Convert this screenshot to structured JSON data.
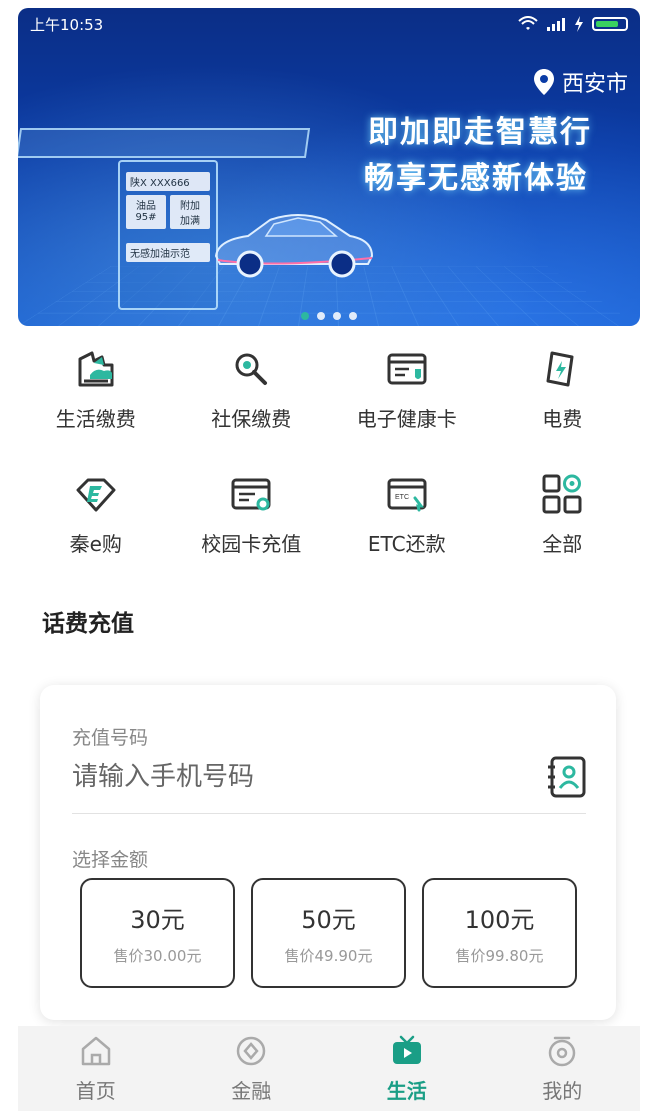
{
  "status_bar": {
    "time": "上午10:53"
  },
  "banner": {
    "location": "西安市",
    "slogan_line1": "即加即走智慧行",
    "slogan_line2": "畅享无感新体验",
    "pump_plate": "陕X XXX666",
    "pump_fuel": "油品\n95#",
    "pump_amount": "附加\n加满",
    "pump_footer": "无感加油示范",
    "dots": 4,
    "active_dot": 0
  },
  "menu": {
    "items": [
      {
        "label": "生活缴费",
        "icon": "house-bill-icon"
      },
      {
        "label": "社保缴费",
        "icon": "search-magnifier-icon"
      },
      {
        "label": "电子健康卡",
        "icon": "health-card-icon"
      },
      {
        "label": "电费",
        "icon": "electric-bolt-card-icon"
      },
      {
        "label": "秦e购",
        "icon": "diamond-e-icon"
      },
      {
        "label": "校园卡充值",
        "icon": "campus-card-icon"
      },
      {
        "label": "ETC还款",
        "icon": "etc-card-icon"
      },
      {
        "label": "全部",
        "icon": "grid-all-icon"
      }
    ]
  },
  "topup": {
    "section_title": "话费充值",
    "number_label": "充值号码",
    "number_placeholder": "请输入手机号码",
    "amount_label": "选择金额",
    "amounts": [
      {
        "face": "30元",
        "price": "售价30.00元"
      },
      {
        "face": "50元",
        "price": "售价49.90元"
      },
      {
        "face": "100元",
        "price": "售价99.80元"
      }
    ]
  },
  "bottom_nav": {
    "items": [
      {
        "label": "首页",
        "icon": "home-icon"
      },
      {
        "label": "金融",
        "icon": "finance-ring-icon"
      },
      {
        "label": "生活",
        "icon": "tv-play-icon"
      },
      {
        "label": "我的",
        "icon": "profile-ring-icon"
      }
    ],
    "active_index": 2
  },
  "colors": {
    "accent": "#1a9e86",
    "banner_blue": "#0b3ca6"
  }
}
